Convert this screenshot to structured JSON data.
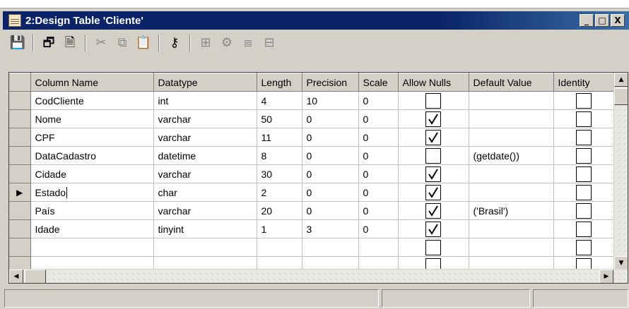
{
  "window": {
    "title": "2:Design Table 'Cliente'",
    "buttons": [
      "_",
      "□",
      "X"
    ]
  },
  "toolbar": [
    {
      "icon": "save-icon",
      "glyph": "💾",
      "enabled": true
    },
    {
      "icon": "properties-icon",
      "glyph": "🗗",
      "enabled": true
    },
    {
      "icon": "generate-script-icon",
      "glyph": "🗎",
      "enabled": true
    },
    {
      "icon": "cut-icon",
      "glyph": "✂",
      "enabled": false
    },
    {
      "icon": "copy-icon",
      "glyph": "⧉",
      "enabled": false
    },
    {
      "icon": "paste-icon",
      "glyph": "📋",
      "enabled": true
    },
    {
      "icon": "primary-key-icon",
      "glyph": "⚷",
      "enabled": true
    },
    {
      "icon": "manage-relationships-icon",
      "glyph": "⊞",
      "enabled": false
    },
    {
      "icon": "manage-indexes-icon",
      "glyph": "⚙",
      "enabled": false
    },
    {
      "icon": "manage-triggers-icon",
      "glyph": "⧈",
      "enabled": false
    },
    {
      "icon": "check-constraints-icon",
      "glyph": "⊟",
      "enabled": false
    }
  ],
  "grid": {
    "headers": [
      "Column Name",
      "Datatype",
      "Length",
      "Precision",
      "Scale",
      "Allow Nulls",
      "Default Value",
      "Identity"
    ],
    "current_row_marker": "▶",
    "rows": [
      {
        "name": "CodCliente",
        "type": "int",
        "length": "4",
        "precision": "10",
        "scale": "0",
        "nulls": false,
        "default": "",
        "identity": false,
        "current": false
      },
      {
        "name": "Nome",
        "type": "varchar",
        "length": "50",
        "precision": "0",
        "scale": "0",
        "nulls": true,
        "default": "",
        "identity": false,
        "current": false
      },
      {
        "name": "CPF",
        "type": "varchar",
        "length": "11",
        "precision": "0",
        "scale": "0",
        "nulls": true,
        "default": "",
        "identity": false,
        "current": false
      },
      {
        "name": "DataCadastro",
        "type": "datetime",
        "length": "8",
        "precision": "0",
        "scale": "0",
        "nulls": false,
        "default": "(getdate())",
        "identity": false,
        "current": false
      },
      {
        "name": "Cidade",
        "type": "varchar",
        "length": "30",
        "precision": "0",
        "scale": "0",
        "nulls": true,
        "default": "",
        "identity": false,
        "current": false
      },
      {
        "name": "Estado",
        "type": "char",
        "length": "2",
        "precision": "0",
        "scale": "0",
        "nulls": true,
        "default": "",
        "identity": false,
        "current": true
      },
      {
        "name": "País",
        "type": "varchar",
        "length": "20",
        "precision": "0",
        "scale": "0",
        "nulls": true,
        "default": "('Brasil')",
        "identity": false,
        "current": false
      },
      {
        "name": "Idade",
        "type": "tinyint",
        "length": "1",
        "precision": "3",
        "scale": "0",
        "nulls": true,
        "default": "",
        "identity": false,
        "current": false
      },
      {
        "name": "",
        "type": "",
        "length": "",
        "precision": "",
        "scale": "",
        "nulls": false,
        "default": "",
        "identity": false,
        "current": false,
        "empty": true
      },
      {
        "name": "",
        "type": "",
        "length": "",
        "precision": "",
        "scale": "",
        "nulls": false,
        "default": "",
        "identity": false,
        "current": false,
        "empty": true
      }
    ]
  },
  "colors": {
    "titlebar": "#0a246a",
    "face": "#d4d0c8"
  }
}
